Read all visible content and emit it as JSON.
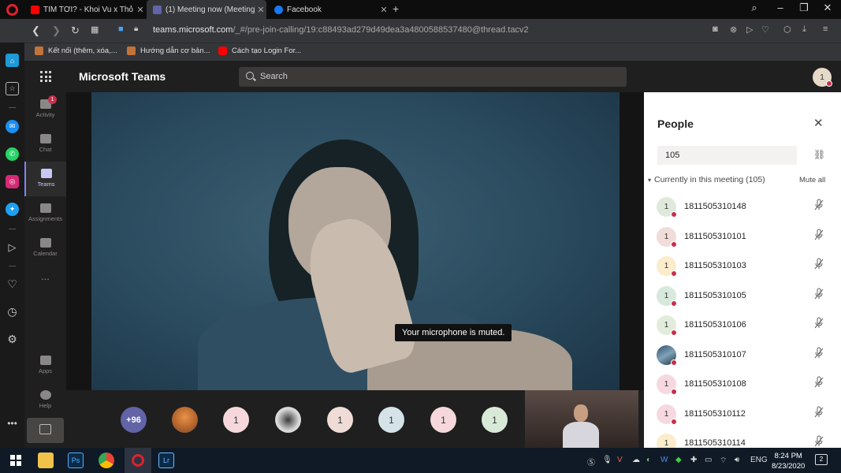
{
  "browser": {
    "tabs": [
      {
        "title": "TÌM TỚI? - Khoi Vu x Thỏ (",
        "icon": "youtube-icon",
        "color": "#ff0000"
      },
      {
        "title": "(1) Meeting now (Meeting)",
        "icon": "teams-icon",
        "color": "#6264a7"
      },
      {
        "title": "Facebook",
        "icon": "facebook-icon",
        "color": "#1877f2"
      }
    ],
    "url_host": "teams.microsoft.com",
    "url_rest": "/_#/pre-join-calling/19:c88493ad279d49dea3a4800588537480@thread.tacv2",
    "bookmarks": [
      {
        "label": "Kết nối (thêm, xóa,...",
        "color": "#c0733a"
      },
      {
        "label": "Hướng dẫn cơ bản...",
        "color": "#c0733a"
      },
      {
        "label": "Cách tạo Login For...",
        "color": "#ff0000"
      }
    ]
  },
  "teams": {
    "brand": "Microsoft Teams",
    "search_placeholder": "Search",
    "me_initial": "1",
    "rail": [
      {
        "label": "Activity",
        "badge": "1"
      },
      {
        "label": "Chat"
      },
      {
        "label": "Teams"
      },
      {
        "label": "Assignments"
      },
      {
        "label": "Calendar"
      },
      {
        "label": "..."
      },
      {
        "label": "Apps"
      },
      {
        "label": "Help"
      }
    ],
    "toast": "Your microphone is muted.",
    "strip": [
      {
        "text": "+96",
        "bg": "#6264a7",
        "fg": "#ffffff"
      },
      {
        "text": "",
        "bg": "#c0803a",
        "photo": true
      },
      {
        "text": "1",
        "bg": "#f6d8dc"
      },
      {
        "text": "",
        "bg": "#d0d0d0",
        "photo": true
      },
      {
        "text": "1",
        "bg": "#efdcd6"
      },
      {
        "text": "1",
        "bg": "#d5e3e8"
      },
      {
        "text": "1",
        "bg": "#f6d8dc"
      },
      {
        "text": "1",
        "bg": "#d8ead7"
      }
    ]
  },
  "people": {
    "title": "People",
    "input_value": "105",
    "section": "Currently in this meeting (105)",
    "mute_all": "Mute all",
    "participants": [
      {
        "name": "1811505310148",
        "initial": "1",
        "bg": "#dfeadc"
      },
      {
        "name": "1811505310101",
        "initial": "1",
        "bg": "#f0dcd8"
      },
      {
        "name": "1811505310103",
        "initial": "1",
        "bg": "#fbeccc"
      },
      {
        "name": "1811505310105",
        "initial": "1",
        "bg": "#d7e8dc"
      },
      {
        "name": "1811505310106",
        "initial": "1",
        "bg": "#e2ecdc"
      },
      {
        "name": "1811505310107",
        "initial": "",
        "bg": "#5b7c95",
        "photo": true
      },
      {
        "name": "1811505310108",
        "initial": "1",
        "bg": "#f6d8e0"
      },
      {
        "name": "1811505310112",
        "initial": "1",
        "bg": "#f6d8e0"
      },
      {
        "name": "1811505310114",
        "initial": "1",
        "bg": "#fbeccc"
      }
    ]
  },
  "taskbar": {
    "apps": [
      {
        "icon": "file-explorer-icon",
        "label": "",
        "color": "#f0c24a"
      },
      {
        "icon": "photoshop-icon",
        "label": "Ps",
        "color": "#0b2a46"
      },
      {
        "icon": "chrome-icon",
        "label": "",
        "color": "#34a853"
      },
      {
        "icon": "opera-icon",
        "label": "",
        "color": "#e0202e"
      },
      {
        "icon": "lightroom-icon",
        "label": "Lr",
        "color": "#0b2a46"
      }
    ],
    "lang": "ENG",
    "time": "8:24 PM",
    "date": "8/23/2020",
    "notifications": "2"
  }
}
